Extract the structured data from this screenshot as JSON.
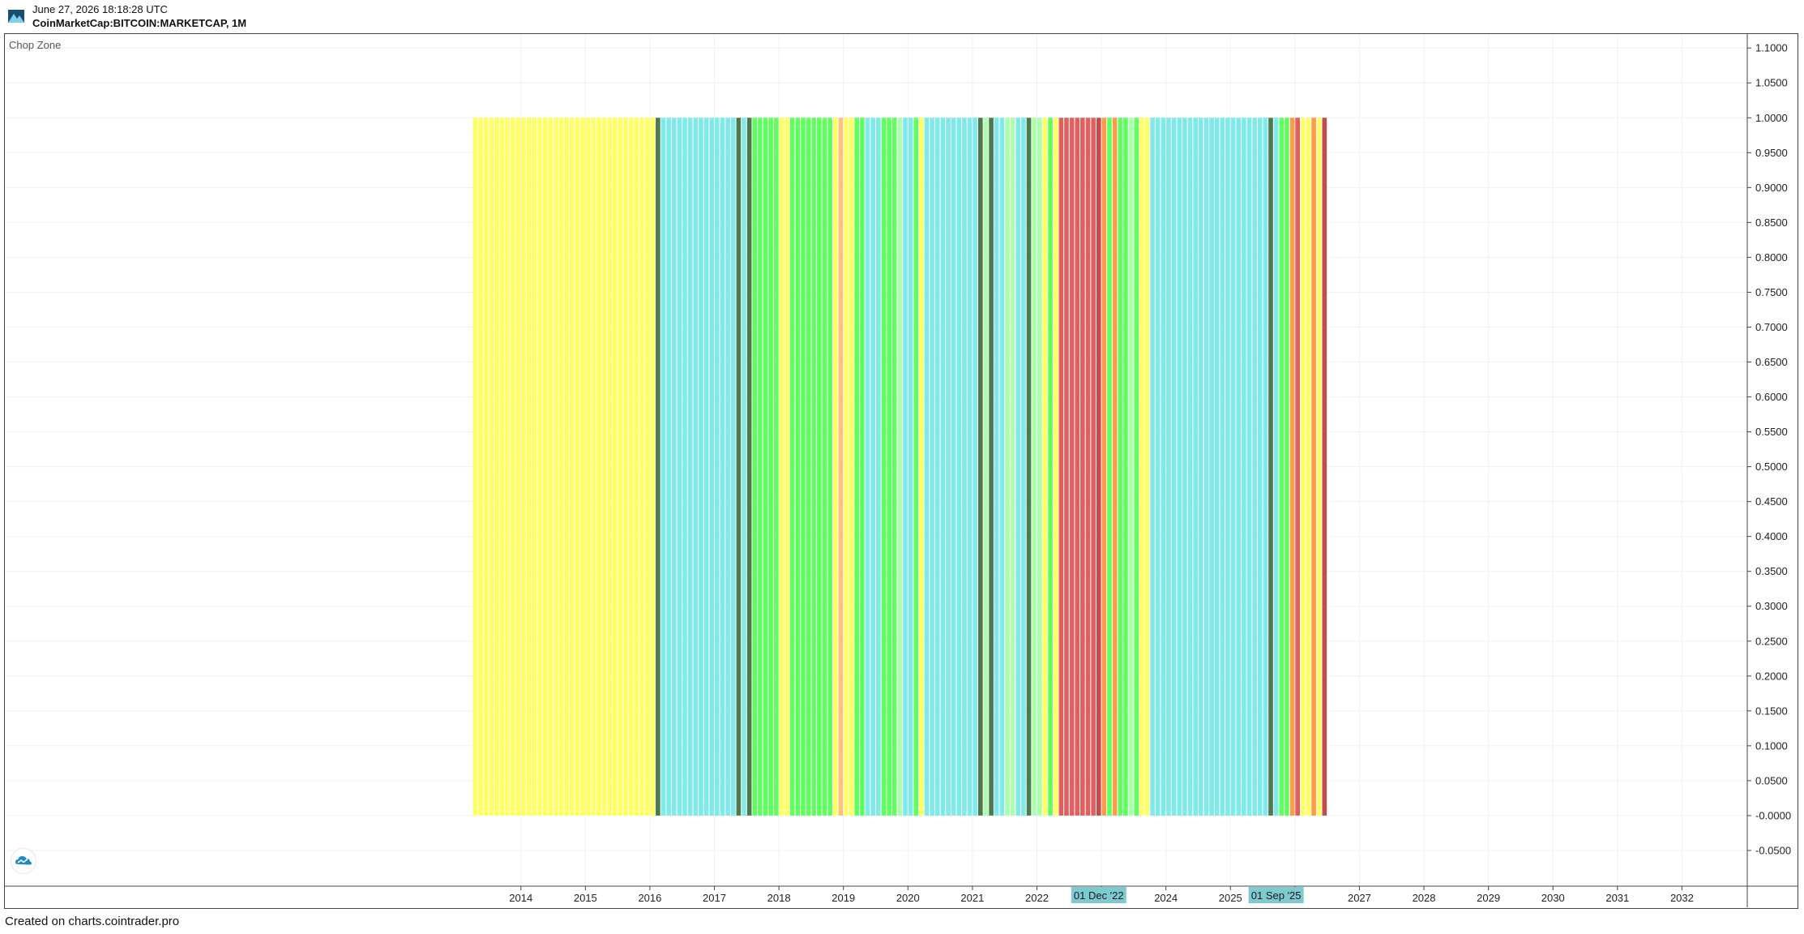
{
  "header": {
    "timestamp": "June 27, 2026 18:18:28 UTC",
    "symbol": "CoinMarketCap:BITCOIN:MARKETCAP, 1M"
  },
  "indicator": {
    "name": "Chop Zone"
  },
  "footer": {
    "text": "Created on charts.cointrader.pro"
  },
  "colors": {
    "turquoise": "#80e9e9",
    "dark_green": "#4c7a4c",
    "bright_green": "#5eff5e",
    "light_green": "#adffad",
    "yellow": "#ffff66",
    "light_orange": "#ffc17f",
    "orange": "#ff9a4a",
    "red": "#e06060",
    "dark_red": "#c24c4c",
    "grid": "#eef1f4",
    "badge": "#7ecad1"
  },
  "chart_data": {
    "type": "bar",
    "title": "Chop Zone",
    "xlabel": "",
    "ylabel": "",
    "ylim": [
      -0.1,
      1.12
    ],
    "y_tick_labels": [
      "1.1000",
      "1.0500",
      "1.0000",
      "0.9500",
      "0.9000",
      "0.8500",
      "0.8000",
      "0.7500",
      "0.7000",
      "0.6500",
      "0.6000",
      "0.5500",
      "0.5000",
      "0.4500",
      "0.4000",
      "0.3500",
      "0.3000",
      "0.2500",
      "0.2000",
      "0.1500",
      "0.1000",
      "0.0500",
      "-0.0000",
      "-0.0500"
    ],
    "x_tick_labels": [
      "2014",
      "2015",
      "2016",
      "2017",
      "2018",
      "2019",
      "2020",
      "2021",
      "2022",
      "",
      "2024",
      "2025",
      "",
      "2027",
      "2028",
      "2029",
      "2030",
      "2031",
      "2032"
    ],
    "x_badges": [
      "01 Dec '22",
      "01 Sep '25"
    ],
    "bar_value": 1,
    "start_month": "2013-04",
    "end_month": "2026-06",
    "x_range": [
      "2006-01",
      "2033-01"
    ],
    "segments": [
      {
        "from": "2013-04",
        "to": "2016-01",
        "color": "yellow"
      },
      {
        "from": "2016-02",
        "to": "2016-02",
        "color": "dark_green"
      },
      {
        "from": "2016-03",
        "to": "2017-04",
        "color": "turquoise"
      },
      {
        "from": "2017-05",
        "to": "2017-05",
        "color": "dark_green"
      },
      {
        "from": "2017-06",
        "to": "2017-06",
        "color": "turquoise"
      },
      {
        "from": "2017-07",
        "to": "2017-07",
        "color": "dark_green"
      },
      {
        "from": "2017-08",
        "to": "2017-12",
        "color": "bright_green"
      },
      {
        "from": "2018-01",
        "to": "2018-02",
        "color": "yellow"
      },
      {
        "from": "2018-03",
        "to": "2018-10",
        "color": "bright_green"
      },
      {
        "from": "2018-11",
        "to": "2018-11",
        "color": "yellow"
      },
      {
        "from": "2018-12",
        "to": "2018-12",
        "color": "light_orange"
      },
      {
        "from": "2019-01",
        "to": "2019-02",
        "color": "yellow"
      },
      {
        "from": "2019-03",
        "to": "2019-04",
        "color": "bright_green"
      },
      {
        "from": "2019-05",
        "to": "2019-07",
        "color": "turquoise"
      },
      {
        "from": "2019-08",
        "to": "2019-10",
        "color": "bright_green"
      },
      {
        "from": "2019-11",
        "to": "2019-11",
        "color": "light_green"
      },
      {
        "from": "2019-12",
        "to": "2020-01",
        "color": "turquoise"
      },
      {
        "from": "2020-02",
        "to": "2020-02",
        "color": "bright_green"
      },
      {
        "from": "2020-03",
        "to": "2020-03",
        "color": "yellow"
      },
      {
        "from": "2020-04",
        "to": "2021-01",
        "color": "turquoise"
      },
      {
        "from": "2021-02",
        "to": "2021-02",
        "color": "dark_green"
      },
      {
        "from": "2021-03",
        "to": "2021-03",
        "color": "light_green"
      },
      {
        "from": "2021-04",
        "to": "2021-04",
        "color": "dark_green"
      },
      {
        "from": "2021-05",
        "to": "2021-06",
        "color": "turquoise"
      },
      {
        "from": "2021-07",
        "to": "2021-08",
        "color": "light_green"
      },
      {
        "from": "2021-09",
        "to": "2021-10",
        "color": "turquoise"
      },
      {
        "from": "2021-11",
        "to": "2021-11",
        "color": "dark_green"
      },
      {
        "from": "2021-12",
        "to": "2022-01",
        "color": "light_green"
      },
      {
        "from": "2022-02",
        "to": "2022-02",
        "color": "yellow"
      },
      {
        "from": "2022-03",
        "to": "2022-03",
        "color": "bright_green"
      },
      {
        "from": "2022-04",
        "to": "2022-04",
        "color": "yellow"
      },
      {
        "from": "2022-05",
        "to": "2022-11",
        "color": "red"
      },
      {
        "from": "2022-12",
        "to": "2022-12",
        "color": "dark_red"
      },
      {
        "from": "2023-01",
        "to": "2023-01",
        "color": "orange"
      },
      {
        "from": "2023-02",
        "to": "2023-02",
        "color": "bright_green"
      },
      {
        "from": "2023-03",
        "to": "2023-03",
        "color": "orange"
      },
      {
        "from": "2023-04",
        "to": "2023-05",
        "color": "bright_green"
      },
      {
        "from": "2023-06",
        "to": "2023-06",
        "color": "light_green"
      },
      {
        "from": "2023-07",
        "to": "2023-07",
        "color": "bright_green"
      },
      {
        "from": "2023-08",
        "to": "2023-09",
        "color": "yellow"
      },
      {
        "from": "2023-10",
        "to": "2025-07",
        "color": "turquoise"
      },
      {
        "from": "2025-08",
        "to": "2025-08",
        "color": "dark_green"
      },
      {
        "from": "2025-09",
        "to": "2025-09",
        "color": "turquoise"
      },
      {
        "from": "2025-10",
        "to": "2025-11",
        "color": "bright_green"
      },
      {
        "from": "2025-12",
        "to": "2025-12",
        "color": "orange"
      },
      {
        "from": "2026-01",
        "to": "2026-01",
        "color": "red"
      },
      {
        "from": "2026-02",
        "to": "2026-03",
        "color": "yellow"
      },
      {
        "from": "2026-04",
        "to": "2026-04",
        "color": "orange"
      },
      {
        "from": "2026-05",
        "to": "2026-05",
        "color": "yellow"
      },
      {
        "from": "2026-06",
        "to": "2026-06",
        "color": "dark_red"
      }
    ],
    "grid": true,
    "legend": "none"
  }
}
